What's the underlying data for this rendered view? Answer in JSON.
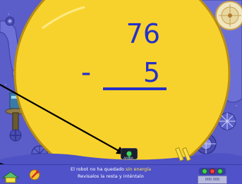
{
  "problem": {
    "minuend": "76",
    "operator": "-",
    "subtrahend": "5"
  },
  "message": {
    "line1_prefix": "El robot no ha quedado",
    "line1_highlight": "sin energía",
    "line2": "Revisalos la resta y inténtalo"
  },
  "hint": {
    "label": "AYUDA"
  },
  "status": {
    "score_label": "000 000"
  },
  "icons": [
    "hint-lightbulb-icon",
    "wrench-icon",
    "home-icon",
    "status-lights-icon",
    "clock-gear-icon"
  ],
  "colors": {
    "background": "#5b5dc8",
    "sun": "#f8d22c",
    "problem_text": "#2430c8",
    "highlight": "#ffe14a"
  }
}
